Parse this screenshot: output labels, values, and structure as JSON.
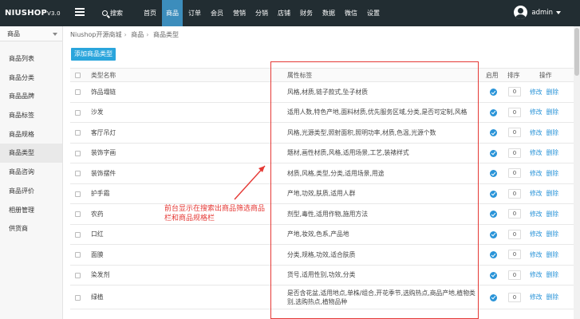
{
  "logo": {
    "text": "NIUSHOP",
    "version": "V3.0"
  },
  "search_label": "搜索",
  "nav": [
    "首页",
    "商品",
    "订单",
    "会员",
    "营销",
    "分销",
    "店铺",
    "财务",
    "数据",
    "微信",
    "设置"
  ],
  "nav_active_index": 1,
  "user": {
    "name": "admin"
  },
  "sidebar": {
    "header": "商品",
    "items": [
      "商品列表",
      "商品分类",
      "商品品牌",
      "商品标签",
      "商品规格",
      "商品类型",
      "商品咨询",
      "商品评价",
      "相册管理",
      "供货商"
    ],
    "active_index": 5
  },
  "breadcrumb": [
    "Niushop开源商城",
    "商品",
    "商品类型"
  ],
  "add_button": "添加商品类型",
  "table": {
    "headers": {
      "name": "类型名称",
      "tags": "属性标签",
      "enabled": "启用",
      "sort": "排序",
      "actions": "操作"
    },
    "edit_label": "修改",
    "delete_label": "删除",
    "rows": [
      {
        "name": "饰品塌链",
        "tags": "风格,材质,链子款式,坠子材质",
        "sort": "0"
      },
      {
        "name": "沙发",
        "tags": "适用人数,特色产地,面料材质,优先服务区域,分类,是否可定制,风格",
        "sort": "0"
      },
      {
        "name": "客厅吊灯",
        "tags": "风格,光源类型,照射面积,照明功率,材质,色温,光源个数",
        "sort": "0"
      },
      {
        "name": "装饰字画",
        "tags": "题材,画性材质,风格,适用场景,工艺,装裱样式",
        "sort": "0"
      },
      {
        "name": "装饰摆件",
        "tags": "材质,风格,类型,分类,适用场景,用途",
        "sort": "0"
      },
      {
        "name": "护手霜",
        "tags": "产地,功效,肤质,适用人群",
        "sort": "0"
      },
      {
        "name": "农药",
        "tags": "剂型,毒性,适用作物,施用方法",
        "sort": "0"
      },
      {
        "name": "口红",
        "tags": "产地,妆效,色系,产品地",
        "sort": "0"
      },
      {
        "name": "面膜",
        "tags": "分类,规格,功效,适合肤质",
        "sort": "0"
      },
      {
        "name": "染发剂",
        "tags": "货号,适用性别,功效,分类",
        "sort": "0"
      },
      {
        "name": "绿植",
        "tags": "是否含花盆,适用地点,单株/组合,开花季节,选购热点,商品产地,植物类别,选购热点,植物品种",
        "sort": "0"
      }
    ]
  },
  "annotation": "前台显示在搜索出商品筛选商品栏和商品规格栏",
  "colors": {
    "topbar": "#222d32",
    "accent": "#3c8dbc",
    "button": "#2aa5dc",
    "link": "#2a94d8",
    "annotation": "#e53935"
  }
}
